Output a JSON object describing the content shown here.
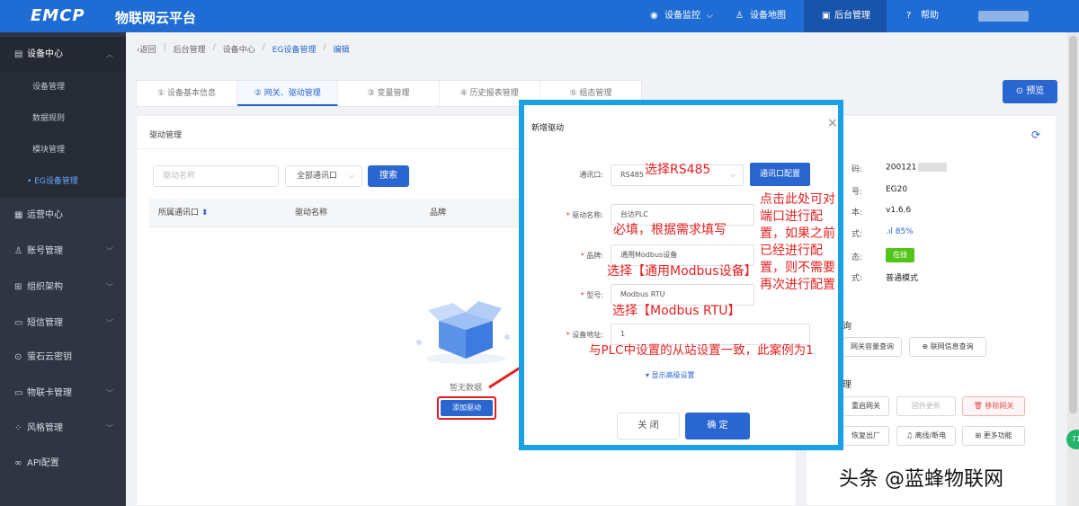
{
  "header": {
    "logo_text": "EMCP",
    "platform_name": "物联网云平台",
    "nav": [
      {
        "label": "设备监控",
        "icon": "monitor-icon"
      },
      {
        "label": "设备地图",
        "icon": "user-icon"
      },
      {
        "label": "后台管理",
        "icon": "computer-icon"
      },
      {
        "label": "帮助",
        "icon": "help-icon"
      }
    ]
  },
  "sidebar": {
    "groups": [
      {
        "label": "设备中心",
        "icon": "device-icon"
      },
      {
        "label": "运营中心",
        "icon": "operation-icon"
      },
      {
        "label": "账号管理",
        "icon": "account-icon"
      },
      {
        "label": "组织架构",
        "icon": "org-icon"
      },
      {
        "label": "短信管理",
        "icon": "sms-icon"
      },
      {
        "label": "萤石云密钥",
        "icon": "key-icon"
      },
      {
        "label": "物联卡管理",
        "icon": "card-icon"
      },
      {
        "label": "风格管理",
        "icon": "style-icon"
      },
      {
        "label": "API配置",
        "icon": "link-icon"
      }
    ],
    "sub_items": [
      "设备管理",
      "数据规则",
      "模块管理",
      "• EG设备管理"
    ]
  },
  "breadcrumb": {
    "back": "返回",
    "items": [
      "后台管理",
      "设备中心",
      "EG设备管理",
      "编辑"
    ]
  },
  "tabs": [
    "① 设备基本信息",
    "② 网关、驱动管理",
    "③ 变量管理",
    "④ 历史报表管理",
    "⑤ 组态管理"
  ],
  "preview_button": "预览",
  "driver_panel": {
    "title": "驱动管理",
    "search_placeholder": "驱动名称",
    "port_select": "全部通讯口",
    "search_button": "搜索",
    "columns": [
      "所属通讯口",
      "驱动名称",
      "品牌"
    ],
    "empty_text": "暂无数据",
    "add_button": "添加驱动"
  },
  "device_info": {
    "rows": [
      {
        "label": "码:",
        "value": "200121"
      },
      {
        "label": "号:",
        "value": "EG20"
      },
      {
        "label": "本:",
        "value": "v1.6.6"
      },
      {
        "label": "式:",
        "value": "85%"
      },
      {
        "label": "态:",
        "value": "在线"
      },
      {
        "label": "式:",
        "value": "普通模式"
      }
    ],
    "query_section": "询",
    "query_buttons": [
      "网关容量查询",
      "联网信息查询"
    ],
    "manage_section": "理",
    "manage_buttons": [
      "重启网关",
      "固件更新",
      "移除网关",
      "恢复出厂",
      "离线/断电",
      "更多功能"
    ]
  },
  "modal": {
    "title": "新增驱动",
    "fields": [
      {
        "label": "通讯口:",
        "required": false,
        "value": "RS485"
      },
      {
        "label": "驱动名称:",
        "required": true,
        "value": "台达PLC"
      },
      {
        "label": "品牌:",
        "required": true,
        "value": "通用Modbus设备"
      },
      {
        "label": "型号:",
        "required": true,
        "value": "Modbus RTU"
      },
      {
        "label": "设备地址:",
        "required": true,
        "value": "1"
      }
    ],
    "port_config_button": "通讯口配置",
    "advanced_link": "▾ 显示高级设置",
    "cancel_button": "关 闭",
    "ok_button": "确 定"
  },
  "annotations": {
    "select_rs485": "选择RS485",
    "required_fill": "必填，根据需求填写",
    "select_brand": "选择【通用Modbus设备】",
    "select_model": "选择【Modbus RTU】",
    "address_note": "与PLC中设置的从站设置一致，此案例为1",
    "port_config_note": [
      "点击此处可对",
      "端口进行配",
      "置，如果之前",
      "已经进行配",
      "置，则不需要",
      "再次进行配置"
    ]
  },
  "watermark": "头条 @蓝蜂物联网",
  "floating_badge": "71",
  "colors": {
    "primary": "#2a66cf",
    "topbar": "#1f6cd4",
    "annotation": "#e62020",
    "highlight_frame": "#1aa0e6"
  }
}
